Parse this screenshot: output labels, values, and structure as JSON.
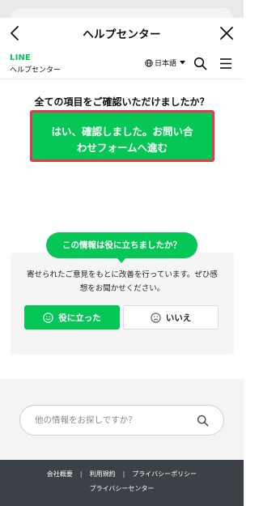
{
  "nav": {
    "title": "ヘルプセンター",
    "back_icon": "chevron-left-icon",
    "close_icon": "close-icon"
  },
  "header": {
    "brand": "LINE",
    "brand_sub": "ヘルプセンター",
    "language": "日本語",
    "globe_icon": "globe-icon",
    "caret_icon": "caret-down-icon",
    "search_icon": "search-icon",
    "menu_icon": "hamburger-menu-icon"
  },
  "confirm": {
    "question": "全ての項目をご確認いただけましたか？",
    "button_line1": "はい、確認しました。お問い合",
    "button_line2": "わせフォームへ進む",
    "highlight_color": "#e8394d"
  },
  "feedback": {
    "bubble": "この情報は役に立ちましたか？",
    "line1": "寄せられたご意見をもとに改善を行っています。ぜひ感",
    "line2": "想をお聞かせください。",
    "yes_label": "役に立った",
    "yes_icon": "smile-icon",
    "no_label": "いいえ",
    "no_icon": "frown-icon"
  },
  "search": {
    "placeholder": "他の情報をお探しですか？",
    "icon": "search-icon"
  },
  "footer": {
    "links": [
      "会社概要",
      "利用規約",
      "プライバシーポリシー"
    ],
    "separator": "|",
    "link_bottom": "プライバシーセンター"
  },
  "colors": {
    "brand_green": "#06c755",
    "footer_bg": "#3c4047"
  }
}
